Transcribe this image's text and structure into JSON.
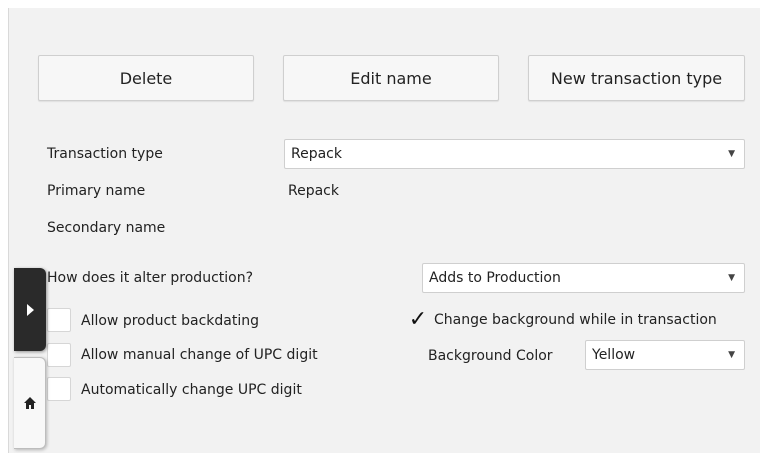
{
  "buttons": {
    "delete": "Delete",
    "edit_name": "Edit name",
    "new_transaction_type": "New transaction type"
  },
  "form": {
    "transaction_type_label": "Transaction type",
    "transaction_type_value": "Repack",
    "primary_name_label": "Primary name",
    "primary_name_value": "Repack",
    "secondary_name_label": "Secondary name",
    "secondary_name_value": "",
    "alter_production_label": "How does it alter production?",
    "alter_production_value": "Adds to Production",
    "background_color_label": "Background Color",
    "background_color_value": "Yellow"
  },
  "options": {
    "allow_backdating": {
      "label": "Allow product backdating",
      "checked": false
    },
    "allow_manual_upc": {
      "label": "Allow manual change of UPC digit",
      "checked": false
    },
    "auto_change_upc": {
      "label": "Automatically change UPC digit",
      "checked": false
    },
    "change_background": {
      "label": "Change background while in transaction",
      "checked": true
    }
  },
  "icons": {
    "dropdown": "chevron-down-icon",
    "check": "checkmark-icon",
    "drawer": "play-arrow-icon",
    "home": "home-icon"
  }
}
